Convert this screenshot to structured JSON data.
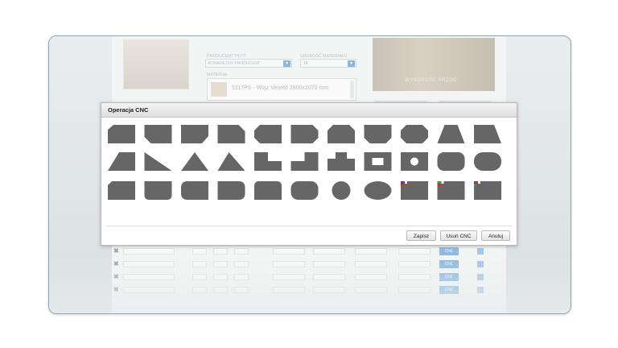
{
  "background": {
    "producer_label": "PRODUCENT PŁYT",
    "producer_value": "KONKRETNY PRODUCENT",
    "thickness_label": "GRUBOŚĆ MATERIAŁU",
    "thickness_value": "18",
    "material_label": "MATERIAŁ",
    "material_value": "5117PS - Wiąz Veneto 2800x2070 mm",
    "photo_caption": "WYSOKOŚĆ PRZOD",
    "cnc_label": "CNC",
    "row_delete_glyph": "✖"
  },
  "dialog": {
    "title": "Operacja CNC",
    "buttons": {
      "save": "Zapisz",
      "remove": "Usuń CNC",
      "cancel": "Anuluj"
    }
  },
  "shape_fill": "#666666",
  "shape_marker_colors": [
    "#3b4bb0",
    "#cc2a2a",
    "#2f9e3a"
  ]
}
